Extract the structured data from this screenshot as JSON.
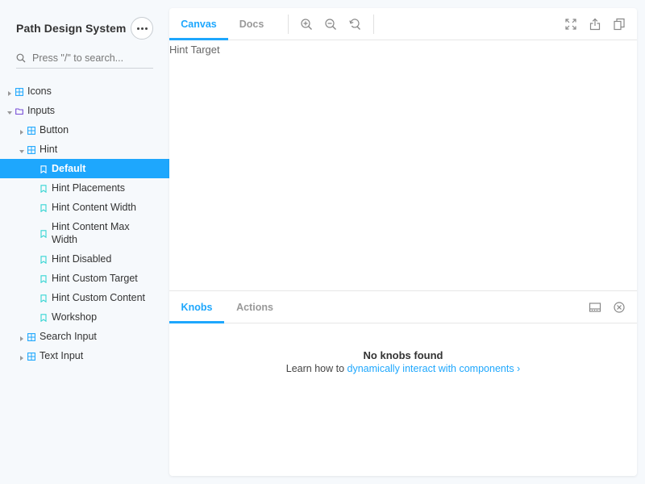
{
  "sidebar": {
    "title": "Path Design System",
    "more_icon": "ellipsis-icon",
    "search_placeholder": "Press \"/\" to search...",
    "search_value": "",
    "tree": [
      {
        "label": "Icons",
        "depth": 0,
        "kind": "component",
        "expanded": false
      },
      {
        "label": "Inputs",
        "depth": 0,
        "kind": "folder",
        "expanded": true
      },
      {
        "label": "Button",
        "depth": 1,
        "kind": "component",
        "expanded": false
      },
      {
        "label": "Hint",
        "depth": 1,
        "kind": "component",
        "expanded": true
      },
      {
        "label": "Default",
        "depth": 2,
        "kind": "story",
        "selected": true
      },
      {
        "label": "Hint Placements",
        "depth": 2,
        "kind": "story"
      },
      {
        "label": "Hint Content Width",
        "depth": 2,
        "kind": "story"
      },
      {
        "label": "Hint Content Max Width",
        "depth": 2,
        "kind": "story"
      },
      {
        "label": "Hint Disabled",
        "depth": 2,
        "kind": "story"
      },
      {
        "label": "Hint Custom Target",
        "depth": 2,
        "kind": "story"
      },
      {
        "label": "Hint Custom Content",
        "depth": 2,
        "kind": "story"
      },
      {
        "label": "Workshop",
        "depth": 2,
        "kind": "story"
      },
      {
        "label": "Search Input",
        "depth": 1,
        "kind": "component",
        "expanded": false
      },
      {
        "label": "Text Input",
        "depth": 1,
        "kind": "component",
        "expanded": false
      }
    ]
  },
  "toolbar": {
    "tabs": [
      {
        "label": "Canvas",
        "active": true
      },
      {
        "label": "Docs",
        "active": false
      }
    ],
    "icons": [
      "zoom-in-icon",
      "zoom-out-icon",
      "reset-zoom-icon",
      "fullscreen-icon",
      "share-icon",
      "copy-icon"
    ]
  },
  "canvas": {
    "content": "Hint Target"
  },
  "addons": {
    "tabs": [
      {
        "label": "Knobs",
        "active": true
      },
      {
        "label": "Actions",
        "active": false
      }
    ],
    "icons": [
      "panel-position-icon",
      "close-panel-icon"
    ],
    "empty_title": "No knobs found",
    "learn_prefix": "Learn how to ",
    "learn_link": "dynamically interact with components",
    "learn_suffix": " ›"
  },
  "colors": {
    "accent": "#1ea7fd",
    "component_icon": "#1ea7fd",
    "story_icon": "#37d5d3",
    "folder_icon": "#774dd7"
  }
}
